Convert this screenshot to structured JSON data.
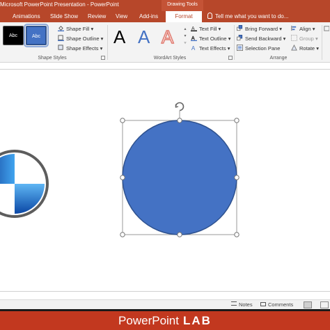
{
  "titlebar": {
    "title": "Microsoft PowerPoint Presentation - PowerPoint",
    "context_group": "Drawing Tools"
  },
  "tabs": {
    "animations": "Animations",
    "slide_show": "Slide Show",
    "review": "Review",
    "view": "View",
    "addins": "Add-ins",
    "format": "Format",
    "tell_me": "Tell me what you want to do..."
  },
  "ribbon": {
    "shape_styles": {
      "label": "Shape Styles",
      "swatch1": "Abc",
      "swatch2": "Abc",
      "shape_fill": "Shape Fill",
      "shape_outline": "Shape Outline",
      "shape_effects": "Shape Effects"
    },
    "wordart_styles": {
      "label": "WordArt Styles",
      "letter": "A",
      "text_fill": "Text Fill",
      "text_outline": "Text Outline",
      "text_effects": "Text Effects"
    },
    "arrange": {
      "label": "Arrange",
      "bring_forward": "Bring Forward",
      "send_backward": "Send Backward",
      "selection_pane": "Selection Pane",
      "align": "Align",
      "group": "Group",
      "rotate": "Rotate"
    }
  },
  "statusbar": {
    "notes": "Notes",
    "comments": "Comments"
  },
  "footer": {
    "brand_word": "PowerPoint",
    "brand_lab": "LAB"
  },
  "colors": {
    "accent": "#b7472a",
    "shape_fill": "#4472c4",
    "footer": "#c2381f"
  }
}
